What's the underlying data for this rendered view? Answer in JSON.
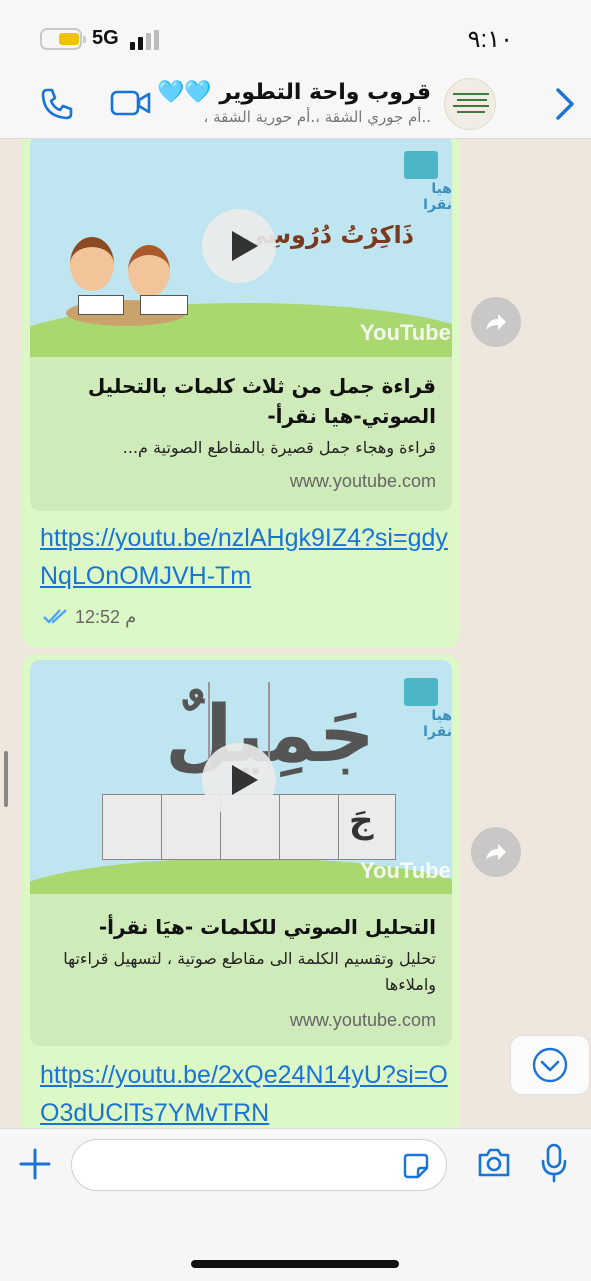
{
  "status_bar": {
    "time": "٩:١٠",
    "network": "5G"
  },
  "header": {
    "title": "قروب واحة التطوير 🩵🩵",
    "subtitle": "..أم جوري الشقة ،.أم حورية الشقة ،"
  },
  "messages": [
    {
      "preview": {
        "thumb_caption": "ذَاكِرْتُ دُرُوسِي",
        "logo_text": "هيا نقرا",
        "yt_watermark": "YouTube",
        "title": "قراءة جمل من ثلاث كلمات بالتحليل الصوتي-هيا نقرأ-",
        "description": "قراءة وهجاء جمل قصيرة بالمقاطع الصوتية م...",
        "domain": "www.youtube.com"
      },
      "link": "https://youtu.be/nzlAHgk9IZ4?si=gdyNqLOnOMJVH-Tm",
      "time": "12:52 م"
    },
    {
      "preview": {
        "thumb_word": "جَمِيلٌ",
        "thumb_box_letter": "جَ",
        "logo_text": "هيا نقرا",
        "yt_watermark": "YouTube",
        "title": "التحليل الصوتي للكلمات -هيَا نقرأ-",
        "description": "تحليل وتقسيم الكلمة الى مقاطع صوتية ، لتسهيل قراءتها واملاءها",
        "domain": "www.youtube.com"
      },
      "link": "https://youtu.be/2xQe24N14yU?si=OO3dUClTs7YMvTRN"
    }
  ],
  "colors": {
    "link": "#1a73d6",
    "bubble": "#dcf8c6",
    "read_ticks": "#4fa3f7"
  }
}
